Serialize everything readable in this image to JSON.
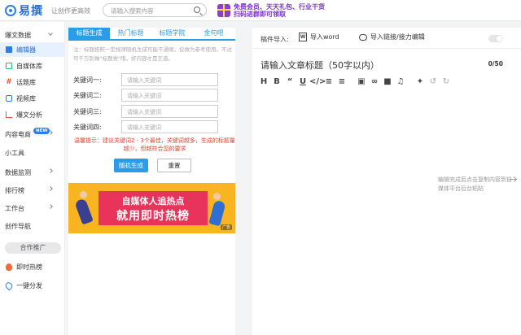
{
  "header": {
    "logo_text": "易撰",
    "slogan": "让创作更高效",
    "search_placeholder": "请输入搜索内容",
    "promo_line1": "免费会员、天天礼包、行业干货",
    "promo_line2": "扫码进群即可领取"
  },
  "sidebar": {
    "section_hot": "爆文数据",
    "sub": [
      "编辑器",
      "自媒体库",
      "话题库",
      "视频库",
      "爆文分析"
    ],
    "content_ecommerce": "内容电商",
    "new_badge": "NEW",
    "tools": "小工具",
    "data_monitor": "数据监测",
    "ranking": "排行榜",
    "workbench": "工作台",
    "creation_nav": "创作导航",
    "coop": "合作推广",
    "hot_list": "即时热榜",
    "one_click": "一键分发"
  },
  "middle": {
    "tabs": [
      "标题生成",
      "热门标题",
      "标题学院",
      "金句吧"
    ],
    "note": "注：标题按照一定规律随机生成可能不通顺，仅做为参考使用。不过可千万别做\"标题党\"哦，好内容才是王道。",
    "keywords": [
      {
        "label": "关键词一:",
        "placeholder": "请输入关键词"
      },
      {
        "label": "关键词二:",
        "placeholder": "请输入关键词"
      },
      {
        "label": "关键词三:",
        "placeholder": "请输入关键词"
      },
      {
        "label": "关键词四:",
        "placeholder": "请输入关键词"
      }
    ],
    "tip": "温馨提示：建议关键词2 - 3个最佳，关键词越多，生成的标题量越少，但越符合您的要求",
    "random_btn": "随机生成",
    "reset_btn": "重置",
    "banner_line1": "自媒体人追热点",
    "banner_line2": "就用即时热榜",
    "banner_ad": "广告"
  },
  "editor": {
    "import_label": "稿件导入:",
    "import_word": "导入word",
    "import_link": "导入链接/接力编辑",
    "title_placeholder": "请输入文章标题（50字以内）",
    "counter": "0/50",
    "side_tip": "编辑完成后点击复制内容到自媒体平台后台粘贴"
  }
}
